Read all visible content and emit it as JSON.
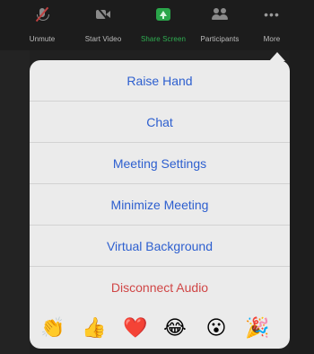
{
  "toolbar": {
    "unmute": {
      "label": "Unmute",
      "icon": "mic-muted-icon"
    },
    "start_video": {
      "label": "Start Video",
      "icon": "video-off-icon"
    },
    "share_screen": {
      "label": "Share Screen",
      "icon": "share-screen-icon",
      "color": "#2fae52"
    },
    "participants": {
      "label": "Participants",
      "icon": "participants-icon"
    },
    "more": {
      "label": "More",
      "icon": "more-dots-icon",
      "glyph": "•••"
    }
  },
  "menu": {
    "items": [
      {
        "label": "Raise Hand"
      },
      {
        "label": "Chat"
      },
      {
        "label": "Meeting Settings"
      },
      {
        "label": "Minimize Meeting"
      },
      {
        "label": "Virtual Background"
      },
      {
        "label": "Disconnect Audio",
        "style": "danger"
      }
    ],
    "accent_color": "#2d5fcf",
    "danger_color": "#d04646"
  },
  "reactions": [
    {
      "name": "clapping-hands",
      "glyph": "👏"
    },
    {
      "name": "thumbs-up",
      "glyph": "👍"
    },
    {
      "name": "red-heart",
      "glyph": "❤️"
    },
    {
      "name": "tears-of-joy",
      "glyph": "😂"
    },
    {
      "name": "face-with-open-mouth",
      "glyph": "😮"
    },
    {
      "name": "party-popper",
      "glyph": "🎉"
    }
  ]
}
